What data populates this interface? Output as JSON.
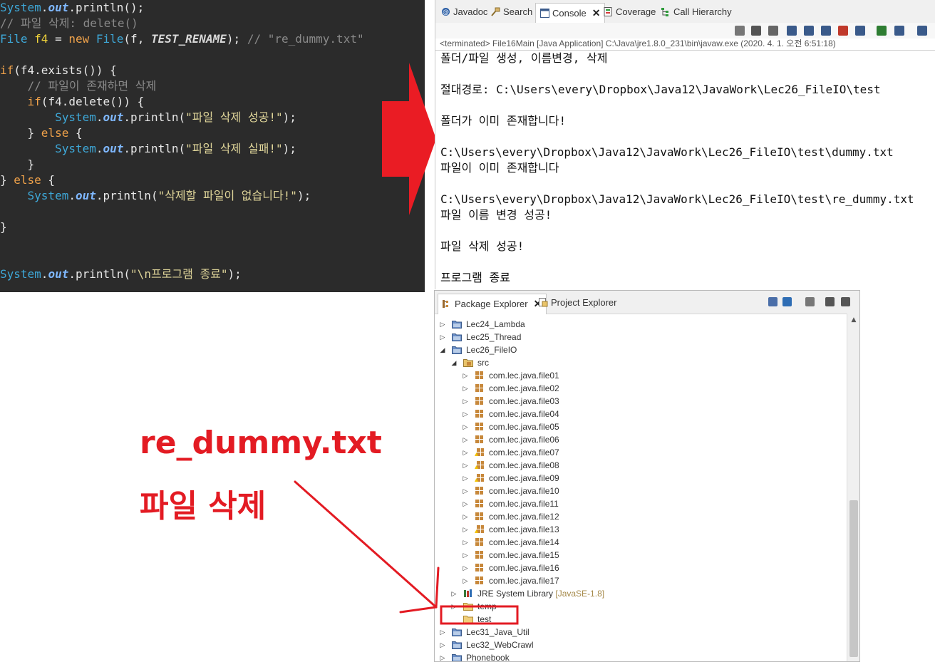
{
  "code_editor": {
    "lines": [
      {
        "tokens": [
          {
            "t": "System",
            "c": "cls"
          },
          {
            "t": ".",
            "c": "pl"
          },
          {
            "t": "out",
            "c": "fld"
          },
          {
            "t": ".println();",
            "c": "pl"
          }
        ]
      },
      {
        "tokens": [
          {
            "t": "// 파일 삭제: delete()",
            "c": "cmt"
          }
        ]
      },
      {
        "tokens": [
          {
            "t": "File ",
            "c": "cls"
          },
          {
            "t": "f4",
            "c": "var"
          },
          {
            "t": " = ",
            "c": "pl"
          },
          {
            "t": "new",
            "c": "kw"
          },
          {
            "t": " ",
            "c": "pl"
          },
          {
            "t": "File",
            "c": "cls"
          },
          {
            "t": "(f, ",
            "c": "pl"
          },
          {
            "t": "TEST_RENAME",
            "c": "const"
          },
          {
            "t": "); ",
            "c": "pl"
          },
          {
            "t": "// \"re_dummy.txt\"",
            "c": "cmt"
          }
        ]
      },
      {
        "tokens": []
      },
      {
        "tokens": [
          {
            "t": "if",
            "c": "kw"
          },
          {
            "t": "(f4.exists()) {",
            "c": "pl"
          }
        ]
      },
      {
        "tokens": [
          {
            "t": "    ",
            "c": "pl"
          },
          {
            "t": "// 파일이 존재하면 삭제",
            "c": "cmt"
          }
        ]
      },
      {
        "tokens": [
          {
            "t": "    ",
            "c": "pl"
          },
          {
            "t": "if",
            "c": "kw"
          },
          {
            "t": "(f4.delete()) {",
            "c": "pl"
          }
        ]
      },
      {
        "tokens": [
          {
            "t": "        ",
            "c": "pl"
          },
          {
            "t": "System",
            "c": "cls"
          },
          {
            "t": ".",
            "c": "pl"
          },
          {
            "t": "out",
            "c": "fld"
          },
          {
            "t": ".println(",
            "c": "pl"
          },
          {
            "t": "\"파일 삭제 성공!\"",
            "c": "str"
          },
          {
            "t": ");",
            "c": "pl"
          }
        ]
      },
      {
        "tokens": [
          {
            "t": "    } ",
            "c": "pl"
          },
          {
            "t": "else",
            "c": "kw"
          },
          {
            "t": " {",
            "c": "pl"
          }
        ]
      },
      {
        "tokens": [
          {
            "t": "        ",
            "c": "pl"
          },
          {
            "t": "System",
            "c": "cls"
          },
          {
            "t": ".",
            "c": "pl"
          },
          {
            "t": "out",
            "c": "fld"
          },
          {
            "t": ".println(",
            "c": "pl"
          },
          {
            "t": "\"파일 삭제 실패!\"",
            "c": "str"
          },
          {
            "t": ");",
            "c": "pl"
          }
        ]
      },
      {
        "tokens": [
          {
            "t": "    }",
            "c": "pl"
          }
        ]
      },
      {
        "tokens": [
          {
            "t": "} ",
            "c": "pl"
          },
          {
            "t": "else",
            "c": "kw"
          },
          {
            "t": " {",
            "c": "pl"
          }
        ]
      },
      {
        "tokens": [
          {
            "t": "    ",
            "c": "pl"
          },
          {
            "t": "System",
            "c": "cls"
          },
          {
            "t": ".",
            "c": "pl"
          },
          {
            "t": "out",
            "c": "fld"
          },
          {
            "t": ".println(",
            "c": "pl"
          },
          {
            "t": "\"삭제할 파일이 없습니다!\"",
            "c": "str"
          },
          {
            "t": ");",
            "c": "pl"
          }
        ]
      },
      {
        "tokens": []
      },
      {
        "tokens": [
          {
            "t": "}",
            "c": "pl"
          }
        ]
      },
      {
        "tokens": []
      },
      {
        "tokens": []
      },
      {
        "tokens": [
          {
            "t": "System",
            "c": "cls"
          },
          {
            "t": ".",
            "c": "pl"
          },
          {
            "t": "out",
            "c": "fld"
          },
          {
            "t": ".println(",
            "c": "pl"
          },
          {
            "t": "\"\\n프로그램 종료\"",
            "c": "str"
          },
          {
            "t": ");",
            "c": "pl"
          }
        ]
      }
    ]
  },
  "console_view": {
    "tabs": [
      {
        "label": "Javadoc",
        "icon": "javadoc-icon",
        "active": false
      },
      {
        "label": "Search",
        "icon": "search-icon",
        "active": false
      },
      {
        "label": "Console",
        "icon": "console-icon",
        "active": true,
        "close": "✕"
      },
      {
        "label": "Coverage",
        "icon": "coverage-icon",
        "active": false
      },
      {
        "label": "Call Hierarchy",
        "icon": "call-hierarchy-icon",
        "active": false
      }
    ],
    "toolbar_icons": [
      "terminate-icon",
      "remove-launch-icon",
      "remove-all-terminated-icon",
      "scroll-lock-icon",
      "word-wrap-icon",
      "show-console-on-stdout-icon",
      "show-console-on-stderr-icon",
      "pin-console-icon",
      "display-selected-console-icon",
      "open-console-icon",
      "new-console-view-icon"
    ],
    "status": "<terminated> File16Main [Java Application] C:\\Java\\jre1.8.0_231\\bin\\javaw.exe (2020. 4. 1. 오전 6:51:18)",
    "output_lines": [
      "폴더/파일 생성, 이름변경, 삭제",
      "",
      "절대경로: C:\\Users\\every\\Dropbox\\Java12\\JavaWork\\Lec26_FileIO\\test",
      "",
      "폴더가 이미 존재합니다!",
      "",
      "C:\\Users\\every\\Dropbox\\Java12\\JavaWork\\Lec26_FileIO\\test\\dummy.txt",
      "파일이 이미 존재합니다",
      "",
      "C:\\Users\\every\\Dropbox\\Java12\\JavaWork\\Lec26_FileIO\\test\\re_dummy.txt",
      "파일 이름 변경 성공!",
      "",
      "파일 삭제 성공!",
      "",
      "프로그램 종료"
    ]
  },
  "package_explorer": {
    "tabs": [
      {
        "label": "Package Explorer",
        "icon": "package-explorer-icon",
        "active": true,
        "close": "✕"
      },
      {
        "label": "Project Explorer",
        "icon": "project-explorer-icon",
        "active": false
      }
    ],
    "toolbar_icons": [
      "collapse-all-icon",
      "link-with-editor-icon",
      "focus-icon",
      "view-menu-icon",
      "minimize-icon"
    ],
    "tree": [
      {
        "label": "Lec24_Lambda",
        "type": "project",
        "level": 0,
        "expanded": false
      },
      {
        "label": "Lec25_Thread",
        "type": "project",
        "level": 0,
        "expanded": false
      },
      {
        "label": "Lec26_FileIO",
        "type": "project",
        "level": 0,
        "expanded": true
      },
      {
        "label": "src",
        "type": "source-folder",
        "level": 1,
        "expanded": true
      },
      {
        "label": "com.lec.java.file01",
        "type": "package",
        "level": 2,
        "expanded": false
      },
      {
        "label": "com.lec.java.file02",
        "type": "package",
        "level": 2,
        "expanded": false
      },
      {
        "label": "com.lec.java.file03",
        "type": "package",
        "level": 2,
        "expanded": false
      },
      {
        "label": "com.lec.java.file04",
        "type": "package",
        "level": 2,
        "expanded": false
      },
      {
        "label": "com.lec.java.file05",
        "type": "package",
        "level": 2,
        "expanded": false
      },
      {
        "label": "com.lec.java.file06",
        "type": "package",
        "level": 2,
        "expanded": false
      },
      {
        "label": "com.lec.java.file07",
        "type": "package-warn",
        "level": 2,
        "expanded": false
      },
      {
        "label": "com.lec.java.file08",
        "type": "package-warn",
        "level": 2,
        "expanded": false
      },
      {
        "label": "com.lec.java.file09",
        "type": "package-warn",
        "level": 2,
        "expanded": false
      },
      {
        "label": "com.lec.java.file10",
        "type": "package",
        "level": 2,
        "expanded": false
      },
      {
        "label": "com.lec.java.file11",
        "type": "package",
        "level": 2,
        "expanded": false
      },
      {
        "label": "com.lec.java.file12",
        "type": "package",
        "level": 2,
        "expanded": false
      },
      {
        "label": "com.lec.java.file13",
        "type": "package-warn",
        "level": 2,
        "expanded": false
      },
      {
        "label": "com.lec.java.file14",
        "type": "package",
        "level": 2,
        "expanded": false
      },
      {
        "label": "com.lec.java.file15",
        "type": "package",
        "level": 2,
        "expanded": false
      },
      {
        "label": "com.lec.java.file16",
        "type": "package",
        "level": 2,
        "expanded": false
      },
      {
        "label": "com.lec.java.file17",
        "type": "package",
        "level": 2,
        "expanded": false
      },
      {
        "label": "JRE System Library",
        "decoration": "[JavaSE-1.8]",
        "type": "library",
        "level": 1,
        "expanded": false
      },
      {
        "label": "temp",
        "type": "folder",
        "level": 1,
        "expanded": false
      },
      {
        "label": "test",
        "type": "folder",
        "level": 1,
        "expanded": null
      },
      {
        "label": "Lec31_Java_Util",
        "type": "project",
        "level": 0,
        "expanded": false
      },
      {
        "label": "Lec32_WebCrawl",
        "type": "project",
        "level": 0,
        "expanded": false
      },
      {
        "label": "Phonebook",
        "type": "project",
        "level": 0,
        "expanded": false
      }
    ]
  },
  "annotation": {
    "title": "re_dummy.txt",
    "subtitle": "파일 삭제",
    "color": "#e31b23"
  },
  "colors": {
    "editor_background": "#2b2b2b",
    "annotation_red": "#e31b23",
    "big_arrow_red": "#ea1c24"
  }
}
